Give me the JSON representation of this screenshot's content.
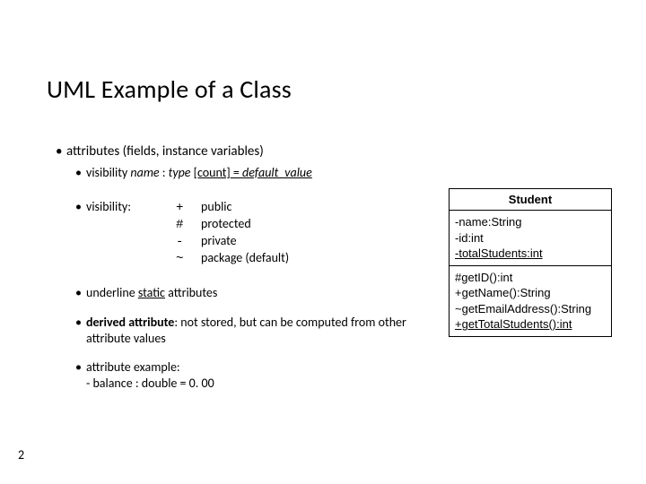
{
  "title": "UML Example of a Class",
  "page_number": "2",
  "bullets": {
    "attributes_heading": "attributes (fields, instance variables)",
    "syntax_prefix": "visibility ",
    "syntax_name": "name",
    "syntax_colon1": " : ",
    "syntax_type": "type",
    "syntax_space": " ",
    "syntax_count": "[count]",
    "syntax_equals": " = ",
    "syntax_default": "default_value",
    "visibility_label": "visibility:",
    "visibility": [
      {
        "sym": "+",
        "mean": "public"
      },
      {
        "sym": "#",
        "mean": "protected"
      },
      {
        "sym": "-",
        "mean": "private"
      },
      {
        "sym": "~",
        "mean": "package (default)"
      }
    ],
    "underline_prefix": "underline ",
    "underline_static": "static",
    "underline_suffix": " attributes",
    "derived_label": "derived attribute",
    "derived_rest": ": not stored, but can be computed from other attribute values",
    "example_label": "attribute example:",
    "example_line": "- balance : double = 0. 00"
  },
  "uml": {
    "class_name": "Student",
    "attrs": [
      "-name:String",
      "-id:int",
      "-totalStudents:int"
    ],
    "attrs_static_index": 2,
    "ops": [
      "#getID():int",
      "+getName():String",
      "~getEmailAddress():String",
      "+getTotalStudents():int"
    ],
    "ops_static_index": 3
  }
}
